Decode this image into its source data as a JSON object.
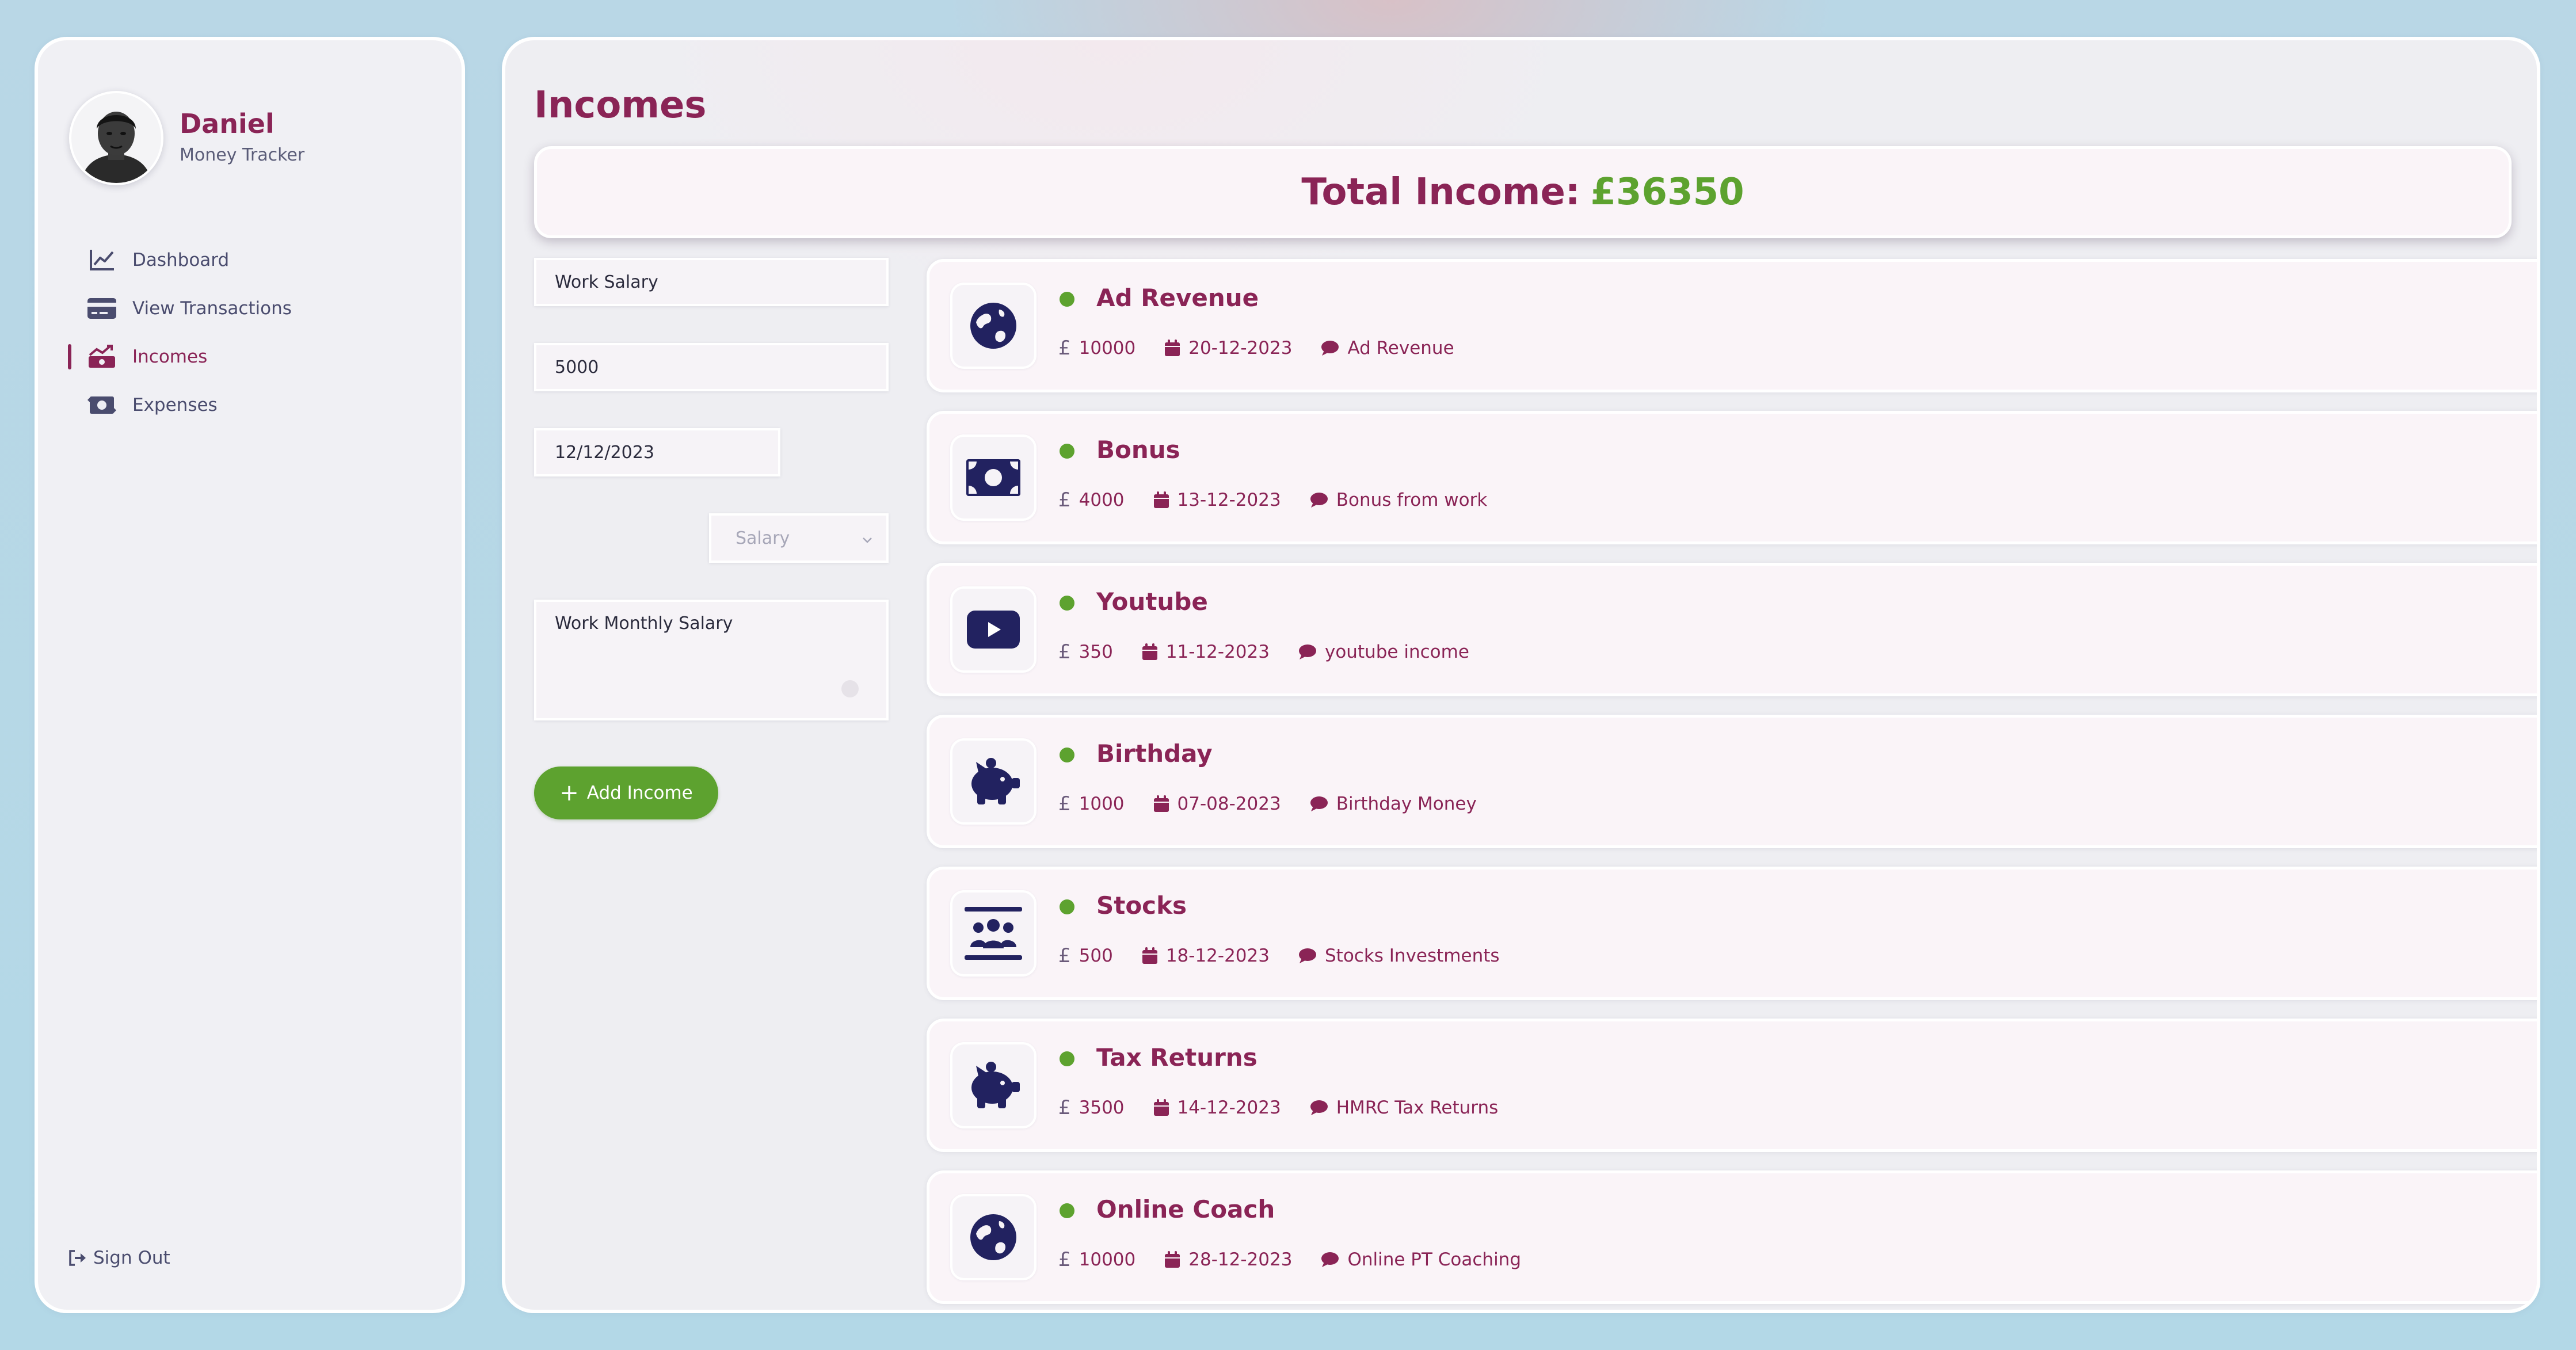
{
  "profile": {
    "name": "Daniel",
    "subtitle": "Money Tracker"
  },
  "nav": [
    {
      "label": "Dashboard",
      "icon": "chart-line-icon",
      "active": false
    },
    {
      "label": "View Transactions",
      "icon": "credit-card-icon",
      "active": false
    },
    {
      "label": "Incomes",
      "icon": "money-bill-trend-up-icon",
      "active": true
    },
    {
      "label": "Expenses",
      "icon": "money-bill-transfer-icon",
      "active": false
    }
  ],
  "signout": {
    "label": "Sign Out",
    "icon": "sign-out-icon"
  },
  "page": {
    "title": "Incomes"
  },
  "total": {
    "label": "Total Income:",
    "amount": "£36350"
  },
  "form": {
    "title_value": "Work Salary",
    "amount_value": "5000",
    "date_value": "12/12/2023",
    "category_value": "Salary",
    "description_value": "Work Monthly Salary",
    "add_label": "Add Income"
  },
  "incomes": [
    {
      "title": "Ad Revenue",
      "amount": "10000",
      "date": "20-12-2023",
      "description": "Ad Revenue",
      "icon": "globe-icon"
    },
    {
      "title": "Bonus",
      "amount": "4000",
      "date": "13-12-2023",
      "description": "Bonus from work",
      "icon": "money-bill-icon"
    },
    {
      "title": "Youtube",
      "amount": "350",
      "date": "11-12-2023",
      "description": "youtube income",
      "icon": "youtube-icon"
    },
    {
      "title": "Birthday",
      "amount": "1000",
      "date": "07-08-2023",
      "description": "Birthday Money",
      "icon": "piggy-bank-icon"
    },
    {
      "title": "Stocks",
      "amount": "500",
      "date": "18-12-2023",
      "description": "Stocks Investments",
      "icon": "people-group-icon"
    },
    {
      "title": "Tax Returns",
      "amount": "3500",
      "date": "14-12-2023",
      "description": "HMRC Tax Returns",
      "icon": "piggy-bank-icon"
    },
    {
      "title": "Online Coach",
      "amount": "10000",
      "date": "28-12-2023",
      "description": "Online PT Coaching",
      "icon": "globe-icon"
    }
  ],
  "currency_symbol": "£",
  "colors": {
    "accent": "#8a2456",
    "success": "#5da22f",
    "icon_navy": "#222260",
    "nav_text": "#4a4c6e"
  }
}
